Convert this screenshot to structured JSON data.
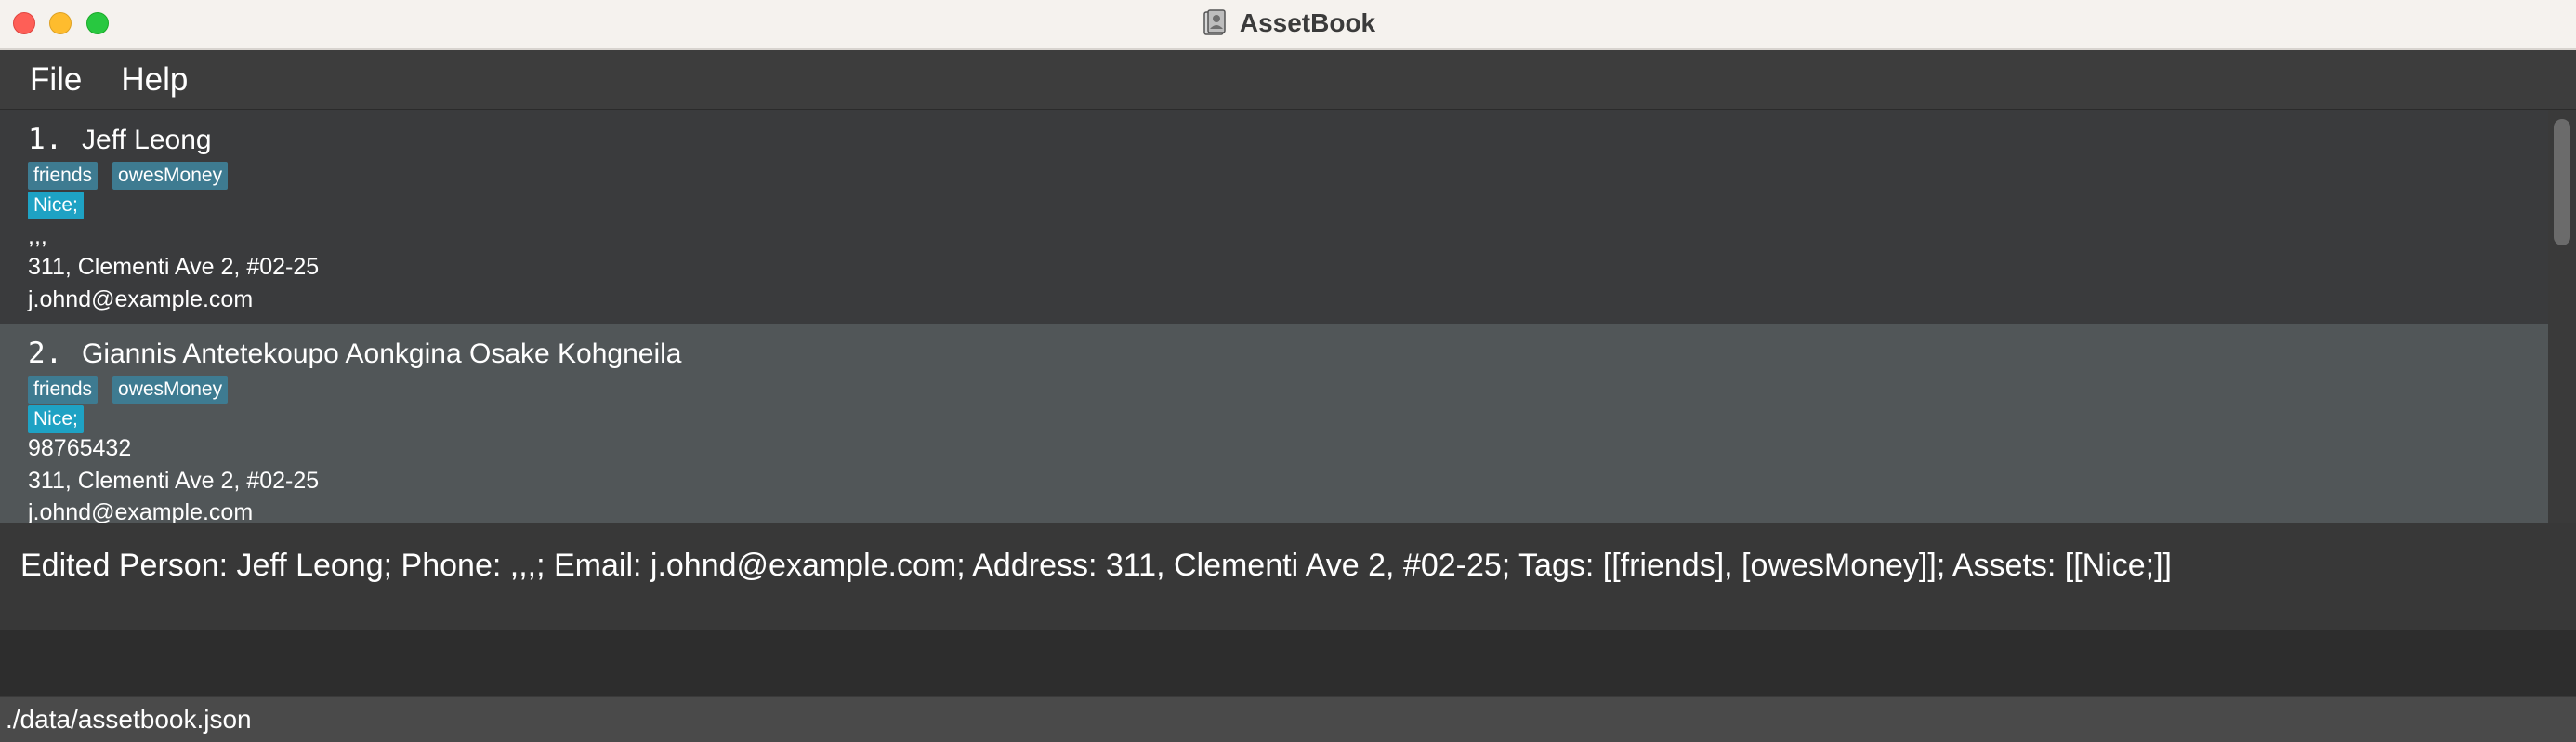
{
  "window": {
    "title": "AssetBook"
  },
  "menu": {
    "file": "File",
    "help": "Help"
  },
  "persons": [
    {
      "index": "1.",
      "name": "Jeff Leong",
      "tags": [
        "friends",
        "owesMoney"
      ],
      "assets": [
        "Nice;"
      ],
      "phone": ",,,",
      "address": "311, Clementi Ave 2, #02-25",
      "email": "j.ohnd@example.com"
    },
    {
      "index": "2.",
      "name": "Giannis Antetekoupo Aonkgina Osake Kohgneila",
      "tags": [
        "friends",
        "owesMoney"
      ],
      "assets": [
        "Nice;"
      ],
      "phone": "98765432",
      "address": "311, Clementi Ave 2, #02-25",
      "email": "j.ohnd@example.com"
    }
  ],
  "result": {
    "message": "Edited Person: Jeff Leong; Phone: ,,,; Email: j.ohnd@example.com; Address: 311, Clementi Ave 2, #02-25; Tags: [[friends], [owesMoney]]; Assets: [[Nice;]]"
  },
  "command": {
    "value": ""
  },
  "status": {
    "path": "./data/assetbook.json"
  },
  "colors": {
    "tag": "#3e7b91",
    "asset": "#1ea2c4",
    "selected_card": "#515658"
  }
}
